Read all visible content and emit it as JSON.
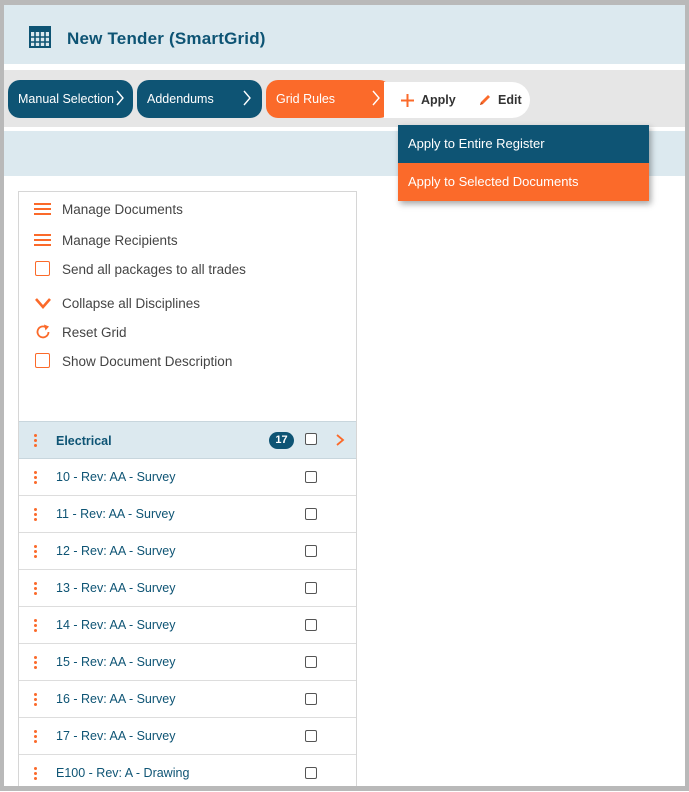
{
  "header": {
    "title": "New Tender (SmartGrid)",
    "icon": "grid-table-icon"
  },
  "toolbar": {
    "steps": [
      {
        "label": "Manual Selection",
        "color": "#0e5474"
      },
      {
        "label": "Addendums",
        "color": "#0e5474"
      },
      {
        "label": "Grid Rules",
        "color": "#fb6a2a",
        "active": true
      }
    ],
    "apply_label": "Apply",
    "edit_label": "Edit"
  },
  "dropdown": {
    "items": [
      {
        "label": "Apply to Entire Register"
      },
      {
        "label": "Apply to Selected Documents",
        "highlighted": true
      }
    ]
  },
  "options": [
    {
      "label": "Manage Documents",
      "icon": "hamburger-icon"
    },
    {
      "label": "Manage Recipients",
      "icon": "hamburger-icon"
    },
    {
      "label": "Send all packages to all trades",
      "icon": "checkbox-icon"
    },
    {
      "label": "Collapse all Disciplines",
      "icon": "chevron-down-icon"
    },
    {
      "label": "Reset Grid",
      "icon": "refresh-icon"
    },
    {
      "label": "Show Document Description",
      "icon": "checkbox-icon"
    }
  ],
  "group": {
    "label": "Electrical",
    "count": "17"
  },
  "rows": [
    {
      "label": "10 - Rev: AA - Survey"
    },
    {
      "label": "11 - Rev: AA - Survey"
    },
    {
      "label": "12 - Rev: AA - Survey"
    },
    {
      "label": "13 - Rev: AA - Survey"
    },
    {
      "label": "14 - Rev: AA - Survey"
    },
    {
      "label": "15 - Rev: AA - Survey"
    },
    {
      "label": "16 - Rev: AA - Survey"
    },
    {
      "label": "17 - Rev: AA - Survey"
    },
    {
      "label": "E100 - Rev: A - Drawing"
    }
  ],
  "colors": {
    "brand_blue": "#0e5474",
    "accent_orange": "#fb6a2a",
    "light_blue": "#dce9ef"
  }
}
